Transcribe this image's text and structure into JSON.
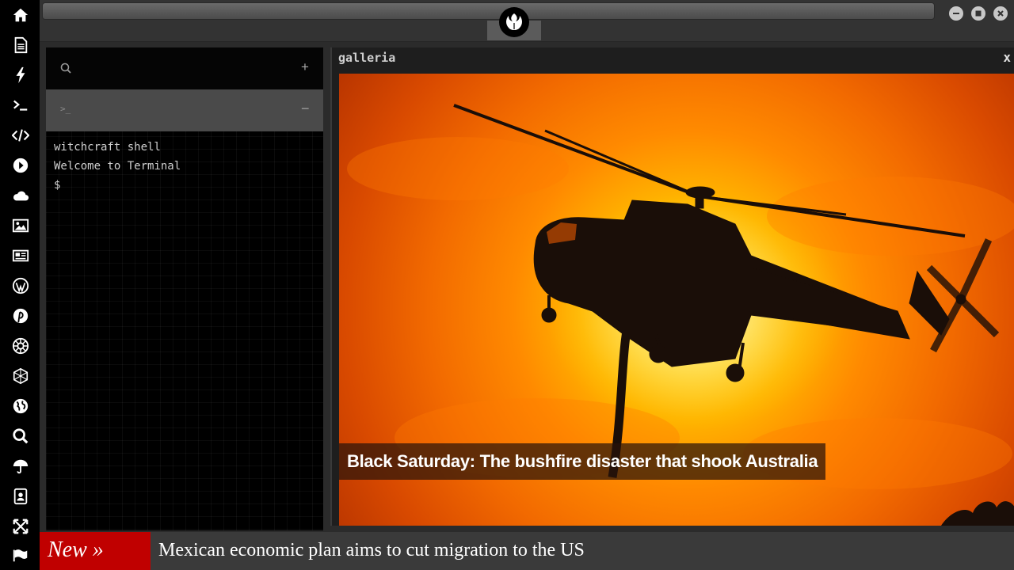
{
  "sidebar": {
    "icons": [
      "home-icon",
      "document-icon",
      "lightning-icon",
      "terminal-icon",
      "code-icon",
      "play-icon",
      "cloud-icon",
      "image-icon",
      "newspaper-icon",
      "wordpress-icon",
      "pinterest-icon",
      "empire-icon",
      "sphere-icon",
      "globe-icon",
      "search-icon",
      "umbrella-icon",
      "contacts-icon",
      "expand-icon",
      "flag-icon"
    ]
  },
  "topbar": {
    "logo": "rebel-alliance-icon",
    "window_controls": [
      "minimize-icon",
      "maximize-icon",
      "close-icon"
    ]
  },
  "terminal": {
    "search_icon": "search-icon",
    "add_symbol": "+",
    "prompt_symbol": ">_",
    "collapse_symbol": "−",
    "lines": [
      "witchcraft shell",
      "Welcome to Terminal",
      "$"
    ]
  },
  "gallery": {
    "title": "galleria",
    "close_label": "x",
    "caption": "Black Saturday: The bushfire disaster that shook Australia"
  },
  "ticker": {
    "badge": "New »",
    "headline": "Mexican economic plan aims to cut migration to the US"
  },
  "colors": {
    "accent_red": "#c00000",
    "rail": "#000000",
    "chrome": "#333333"
  }
}
